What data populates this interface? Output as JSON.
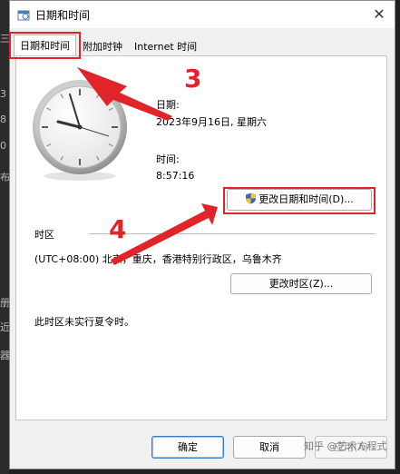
{
  "window": {
    "title": "日期和时间"
  },
  "tabs": [
    {
      "label": "日期和时间"
    },
    {
      "label": "附加时钟"
    },
    {
      "label": "Internet 时间"
    }
  ],
  "date": {
    "label": "日期:",
    "value": "2023年9月16日, 星期六"
  },
  "time": {
    "label": "时间:",
    "value": "8:57:16"
  },
  "change_datetime_button": {
    "label": "更改日期和时间(D)..."
  },
  "timezone": {
    "section_label": "时区",
    "value": "(UTC+08:00) 北京，重庆，香港特别行政区，乌鲁木齐",
    "change_button": "更改时区(Z)...",
    "dst_note": "此时区未实行夏令时。"
  },
  "footer": {
    "ok": "确定",
    "cancel": "取消",
    "apply": "应用(A)"
  },
  "annotations": {
    "step3": "3",
    "step4": "4",
    "watermark": "知乎 @艺术方程式"
  },
  "background_window": {
    "edge_chars": [
      "三",
      "3",
      "8",
      "0",
      "布",
      "册",
      "近",
      "器"
    ]
  },
  "colors": {
    "annotation_red": "#e0242a",
    "primary_button_border": "#3c79c8",
    "window_bg": "#f0f0f0"
  }
}
